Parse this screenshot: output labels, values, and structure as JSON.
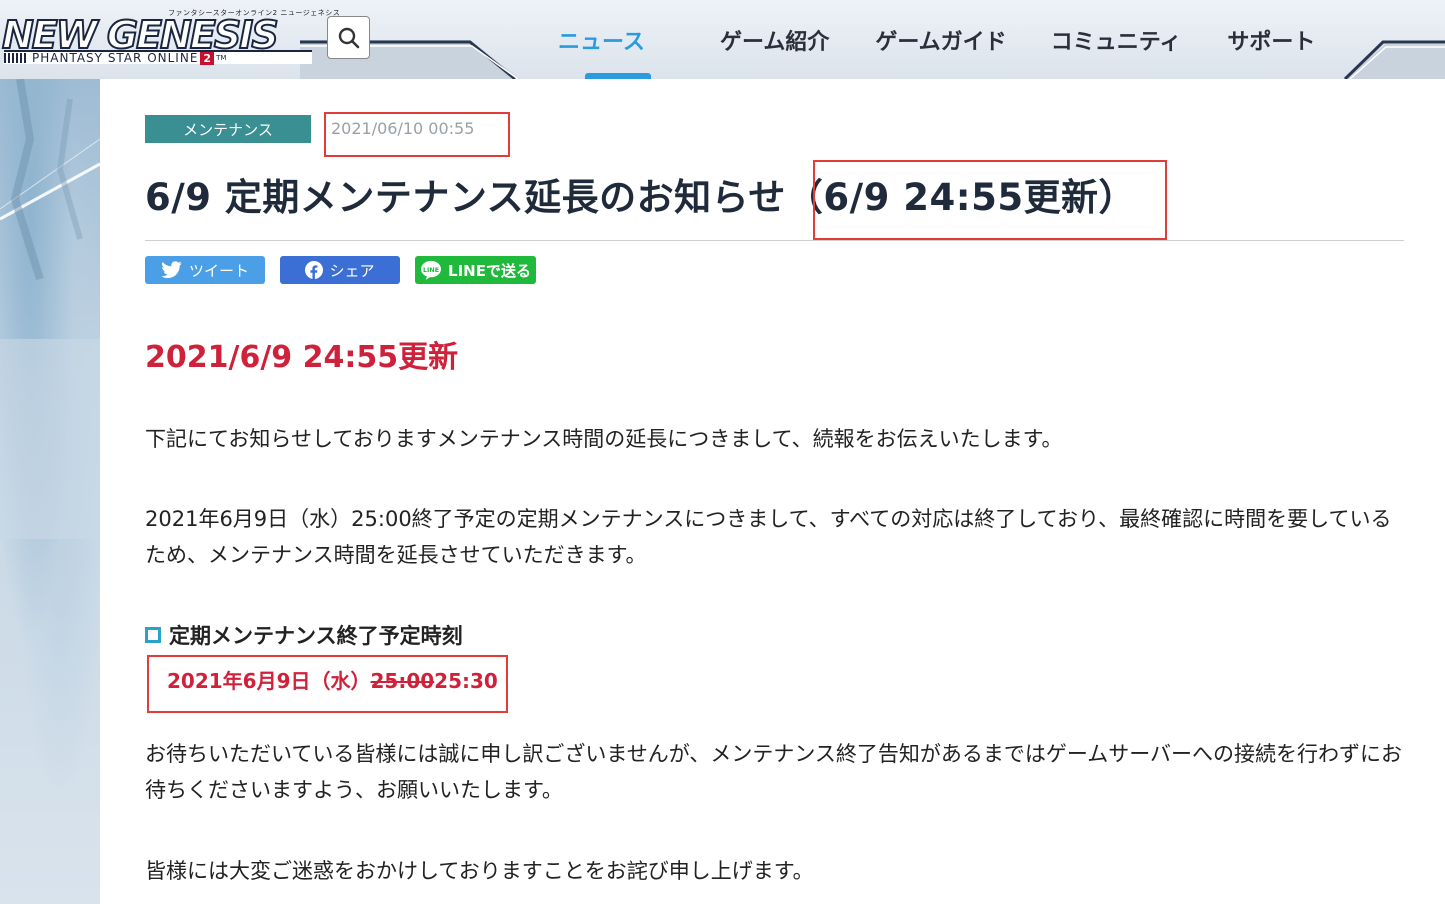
{
  "header": {
    "logo": {
      "small_text": "ファンタシースターオンライン2 ニュージェネシス",
      "main_text": "NEW GENESIS",
      "sub_text": "PHANTASY STAR ONLINE",
      "sub_number": "2",
      "tm": "TM"
    },
    "search_icon": "search-icon",
    "nav": [
      {
        "label": "ニュース",
        "active": true
      },
      {
        "label": "ゲーム紹介",
        "active": false
      },
      {
        "label": "ゲームガイド",
        "active": false
      },
      {
        "label": "コミュニティ",
        "active": false
      },
      {
        "label": "サポート",
        "active": false
      }
    ]
  },
  "article": {
    "category": "メンテナンス",
    "date": "2021/06/10 00:55",
    "title": "6/9 定期メンテナンス延長のお知らせ（6/9 24:55更新）",
    "share": {
      "tweet": "ツイート",
      "facebook": "シェア",
      "line": "LINEで送る"
    },
    "update_heading": "2021/6/9 24:55更新",
    "paragraphs": [
      "下記にてお知らせしておりますメンテナンス時間の延長につきまして、続報をお伝えいたします。",
      "2021年6月9日（水）25:00終了予定の定期メンテナンスにつきまして、すべての対応は終了しており、最終確認に時間を要しているため、メンテナンス時間を延長させていただきます。",
      "お待ちいただいている皆様には誠に申し訳ございませんが、メンテナンス終了告知があるまではゲームサーバーへの接続を行わずにお待ちくださいますよう、お願いいたします。",
      "皆様には大変ご迷惑をおかけしておりますことをお詫び申し上げます。"
    ],
    "section_heading": "定期メンテナンス終了予定時刻",
    "schedule": {
      "date": "2021年6月9日（水）",
      "old_time": "25:00",
      "new_time": "25:30"
    }
  },
  "colors": {
    "accent_blue": "#2b9be0",
    "tag_teal": "#3a8f92",
    "alert_red": "#d0213a",
    "annotation_red": "#e03c3c",
    "twitter": "#4a9fe6",
    "facebook": "#3c6fd6",
    "line": "#1fb93c"
  }
}
